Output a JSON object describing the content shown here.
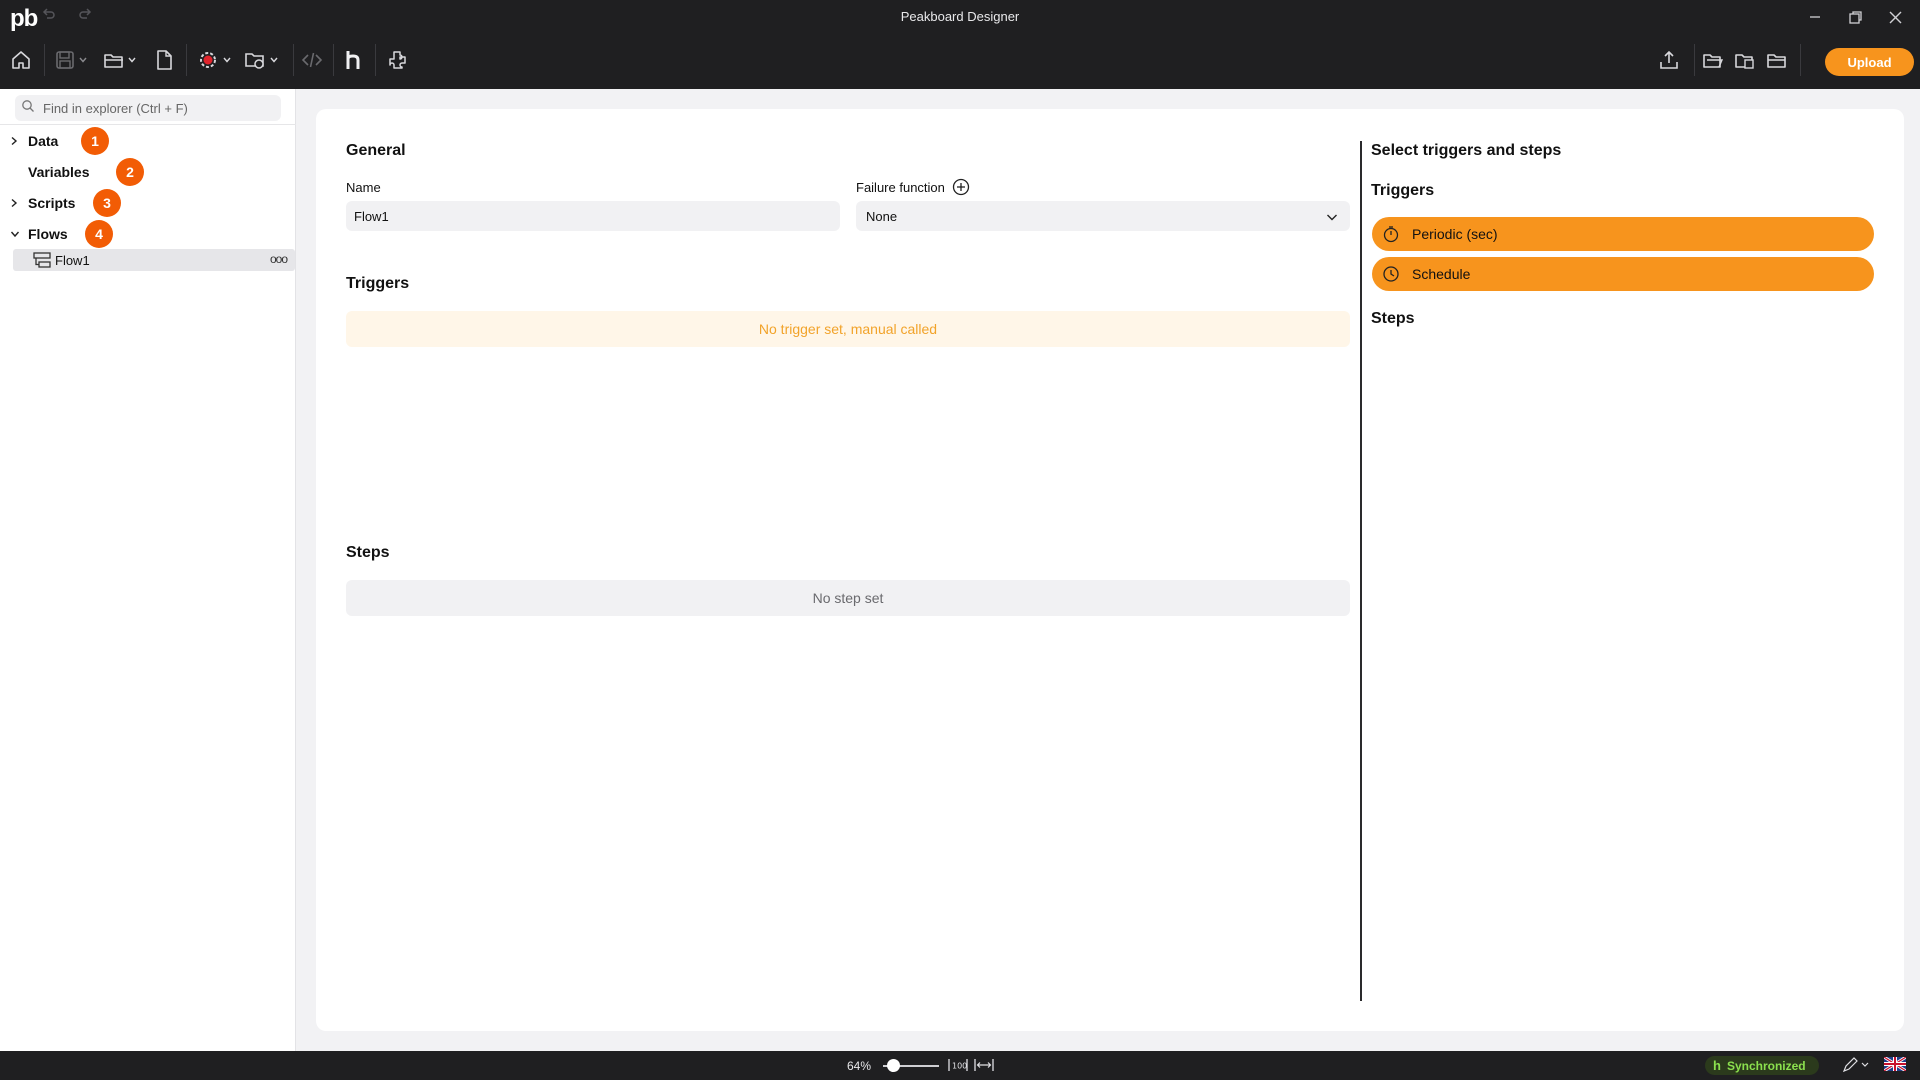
{
  "app": {
    "logo": "pb",
    "title": "Peakboard Designer"
  },
  "toolbar": {
    "upload_label": "Upload"
  },
  "explorer": {
    "search_placeholder": "Find in explorer (Ctrl + F)",
    "items": [
      {
        "label": "Data",
        "badge": "1",
        "expanded": false
      },
      {
        "label": "Variables",
        "badge": "2",
        "expanded": false
      },
      {
        "label": "Scripts",
        "badge": "3",
        "expanded": false
      },
      {
        "label": "Flows",
        "badge": "4",
        "expanded": true
      }
    ],
    "flow_item": {
      "label": "Flow1",
      "more": "ooo"
    }
  },
  "editor": {
    "general_heading": "General",
    "name_label": "Name",
    "name_value": "Flow1",
    "failure_label": "Failure function",
    "failure_value": "None",
    "triggers_heading": "Triggers",
    "triggers_empty": "No trigger set, manual called",
    "steps_heading": "Steps",
    "steps_empty": "No step set"
  },
  "palette": {
    "heading": "Select triggers and steps",
    "triggers_heading": "Triggers",
    "triggers": [
      {
        "label": "Periodic (sec)",
        "icon": "timer-icon"
      },
      {
        "label": "Schedule",
        "icon": "clock-icon"
      }
    ],
    "steps_heading": "Steps"
  },
  "statusbar": {
    "zoom": "64%",
    "sync_label": "Synchronized",
    "sync_prefix": "h"
  },
  "colors": {
    "accent": "#f7941d",
    "badge": "#f25c05",
    "chrome": "#1f1f21",
    "sync": "#8be04e"
  }
}
